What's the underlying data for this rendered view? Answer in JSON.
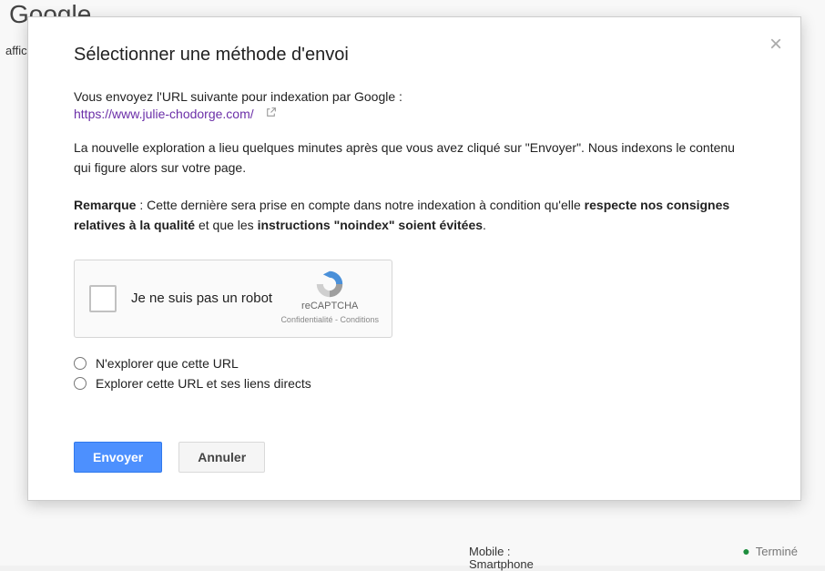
{
  "background": {
    "brand": "Google",
    "word_affiche": "affiche",
    "mobile_line": "Mobile :",
    "smartphone_line": "Smartphone",
    "termine": "Terminé"
  },
  "modal": {
    "title": "Sélectionner une méthode d'envoi",
    "intro": "Vous envoyez l'URL suivante pour indexation par Google :",
    "url": "https://www.julie-chodorge.com/",
    "para1": "La nouvelle exploration a lieu quelques minutes après que vous avez cliqué sur \"Envoyer\". Nous indexons le contenu qui figure alors sur votre page.",
    "note_label": "Remarque",
    "note_before": " : Cette dernière sera prise en compte dans notre indexation à condition qu'elle ",
    "note_bold1": "respecte nos consignes relatives à la qualité",
    "note_mid": " et que les ",
    "note_bold2": "instructions \"noindex\" soient évitées",
    "note_after": ".",
    "recaptcha": {
      "label": "Je ne suis pas un robot",
      "brand": "reCAPTCHA",
      "terms": "Confidentialité - Conditions"
    },
    "radio1": "N'explorer que cette URL",
    "radio2": "Explorer cette URL et ses liens directs",
    "submit": "Envoyer",
    "cancel": "Annuler"
  }
}
